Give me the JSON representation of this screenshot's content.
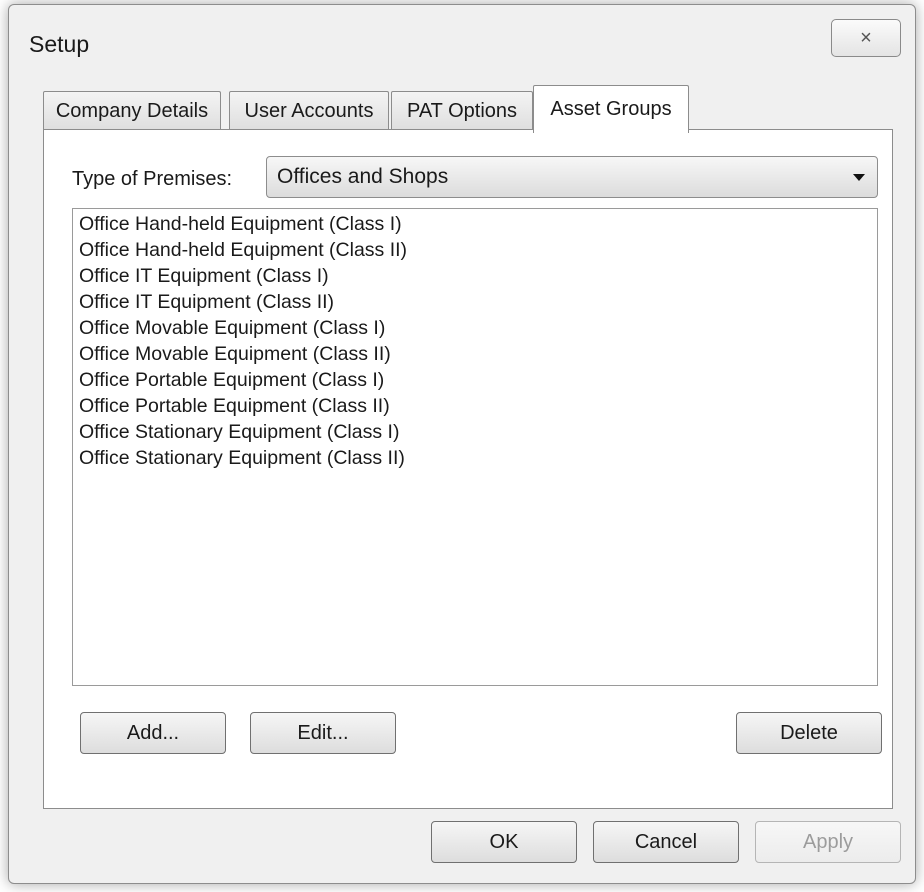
{
  "window": {
    "title": "Setup",
    "close_icon": "×"
  },
  "tabs": [
    {
      "label": "Company Details",
      "active": false
    },
    {
      "label": "User Accounts",
      "active": false
    },
    {
      "label": "PAT Options",
      "active": false
    },
    {
      "label": "Asset Groups",
      "active": true
    }
  ],
  "premises": {
    "label": "Type of Premises:",
    "selected": "Offices and Shops"
  },
  "asset_groups": [
    "Office Hand-held Equipment (Class I)",
    "Office Hand-held Equipment (Class II)",
    "Office IT Equipment (Class I)",
    "Office IT Equipment (Class II)",
    "Office Movable Equipment (Class I)",
    "Office Movable Equipment (Class II)",
    "Office Portable Equipment (Class I)",
    "Office Portable Equipment (Class II)",
    "Office Stationary Equipment (Class I)",
    "Office Stationary Equipment (Class II)"
  ],
  "panel_buttons": {
    "add": "Add...",
    "edit": "Edit...",
    "delete": "Delete"
  },
  "dialog_buttons": {
    "ok": "OK",
    "cancel": "Cancel",
    "apply": "Apply"
  }
}
